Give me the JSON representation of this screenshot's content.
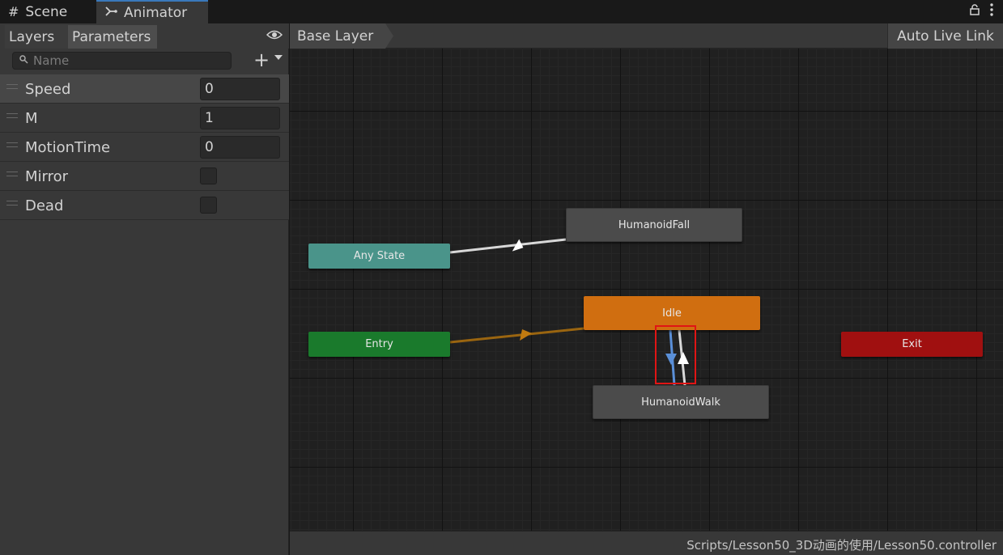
{
  "tabs": {
    "scene": "Scene",
    "animator": "Animator"
  },
  "left_panel": {
    "tab_layers": "Layers",
    "tab_parameters": "Parameters",
    "search_placeholder": "Name",
    "parameters": [
      {
        "name": "Speed",
        "type": "float",
        "value": "0"
      },
      {
        "name": "M",
        "type": "int",
        "value": "1"
      },
      {
        "name": "MotionTime",
        "type": "float",
        "value": "0"
      },
      {
        "name": "Mirror",
        "type": "bool",
        "value": false
      },
      {
        "name": "Dead",
        "type": "bool",
        "value": false
      }
    ]
  },
  "graph": {
    "breadcrumb": "Base Layer",
    "auto_live_link": "Auto Live Link",
    "nodes": {
      "any_state": "Any State",
      "entry": "Entry",
      "exit": "Exit",
      "fall": "HumanoidFall",
      "idle": "Idle",
      "walk": "HumanoidWalk"
    },
    "status_path": "Scripts/Lesson50_3D动画的使用/Lesson50.controller"
  },
  "colors": {
    "accent_tab": "#3a79bb",
    "any_state": "#4a948a",
    "entry": "#1a7a2c",
    "exit": "#a01010",
    "default_state": "#d06e10",
    "state": "#4b4b4b",
    "selected_transition": "#5a8fd8",
    "highlight": "#e01515"
  },
  "icons": {
    "scene_tab": "grid-icon",
    "animator_tab": "animator-icon",
    "lock": "lock-icon",
    "menu": "kebab-menu-icon",
    "visibility": "eye-icon",
    "search": "search-icon",
    "add": "plus-icon"
  }
}
